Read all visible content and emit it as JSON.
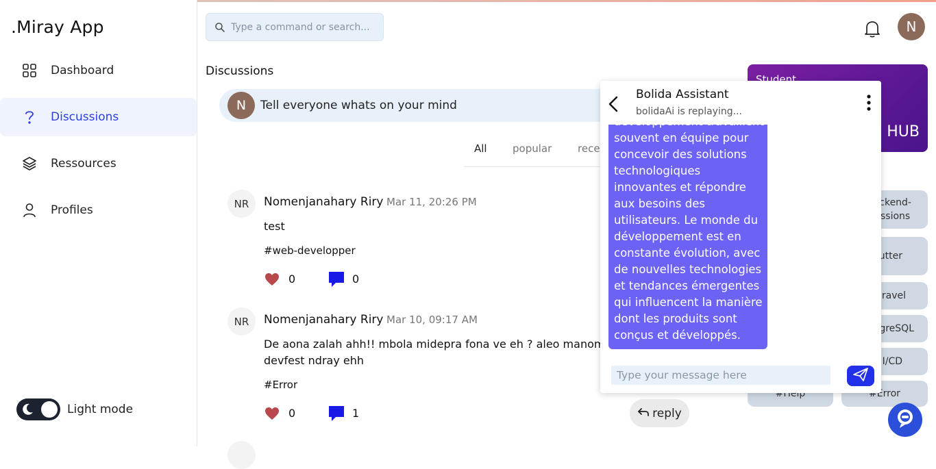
{
  "app": {
    "brand": ".Miray App"
  },
  "sidebar": {
    "items": [
      {
        "label": "Dashboard",
        "icon": "dashboard-grid-icon"
      },
      {
        "label": "Discussions",
        "icon": "question-icon",
        "active": true
      },
      {
        "label": "Ressources",
        "icon": "layers-icon"
      },
      {
        "label": "Profiles",
        "icon": "user-icon"
      }
    ],
    "theme_label": "Light mode"
  },
  "header": {
    "search_placeholder": "Type a command or search...",
    "avatar_initial": "N"
  },
  "main": {
    "title": "Discussions",
    "composer": {
      "avatar": "N",
      "prompt": "Tell everyone whats on your mind"
    },
    "filters": [
      "All",
      "popular",
      "recen"
    ],
    "posts": [
      {
        "initials": "NR",
        "author": "Nomenjanahary Riry",
        "date": "Mar 11, 20:26 PM",
        "body": "test",
        "tag": "#web-developper",
        "likes": "0",
        "comments": "0"
      },
      {
        "initials": "NR",
        "author": "Nomenjanahary Riry",
        "date": "Mar 10, 09:17 AM",
        "body": "De aona zalah ahh!! mbola midepra fona ve eh ? aleo manom\ndevfest ndray ehh",
        "tag": "#Error",
        "likes": "0",
        "comments": "1"
      }
    ],
    "reply_label": "reply"
  },
  "right": {
    "card": {
      "title": "Student",
      "hub": "HUB"
    },
    "chips": [
      "ckend-\nssions",
      "utter",
      "aravel",
      "tgreSQL",
      "I/CD",
      "#Help",
      "#Error"
    ]
  },
  "chat": {
    "title": "Bolida Assistant",
    "status": "bolidaAi is replaying...",
    "message": "développement travaillent souvent en équipe pour concevoir des solutions technologiques innovantes et répondre aux besoins des utilisateurs. Le monde du développement est en constante évolution, avec de nouvelles technologies et tendances émergentes qui influencent la manière dont les produits sont conçus et développés.",
    "input_placeholder": "Type your message here"
  },
  "colors": {
    "accent": "#2d3ee0",
    "bubble": "#6c63f5",
    "send": "#2230e8",
    "heart": "#b8484c",
    "comment": "#1a1ae6",
    "card_gradient_start": "#7b1fa2"
  }
}
